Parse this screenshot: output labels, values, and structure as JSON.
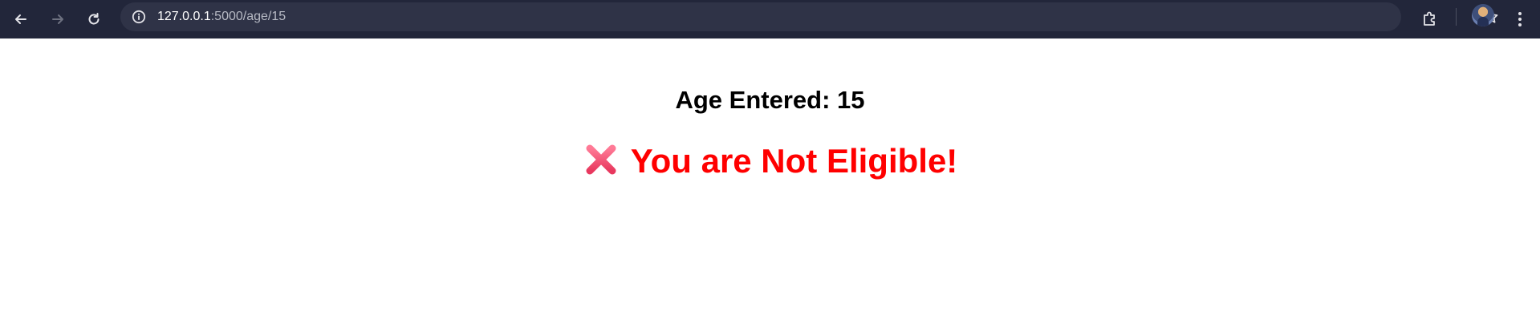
{
  "browser": {
    "url_host": "127.0.0.1",
    "url_path": ":5000/age/15",
    "icons": {
      "back": "back-arrow-icon",
      "forward": "forward-arrow-icon",
      "reload": "reload-icon",
      "site_info": "site-info-icon",
      "bookmark": "star-icon",
      "extensions": "puzzle-icon",
      "menu": "kebab-menu-icon"
    },
    "colors": {
      "toolbar_bg": "#22263a",
      "omnibox_bg": "#2f3347"
    }
  },
  "page": {
    "age_label": "Age Entered: 15",
    "result_icon": "cross-mark-icon",
    "result_text": "You are Not Eligible!",
    "result_color": "#ff0000"
  }
}
